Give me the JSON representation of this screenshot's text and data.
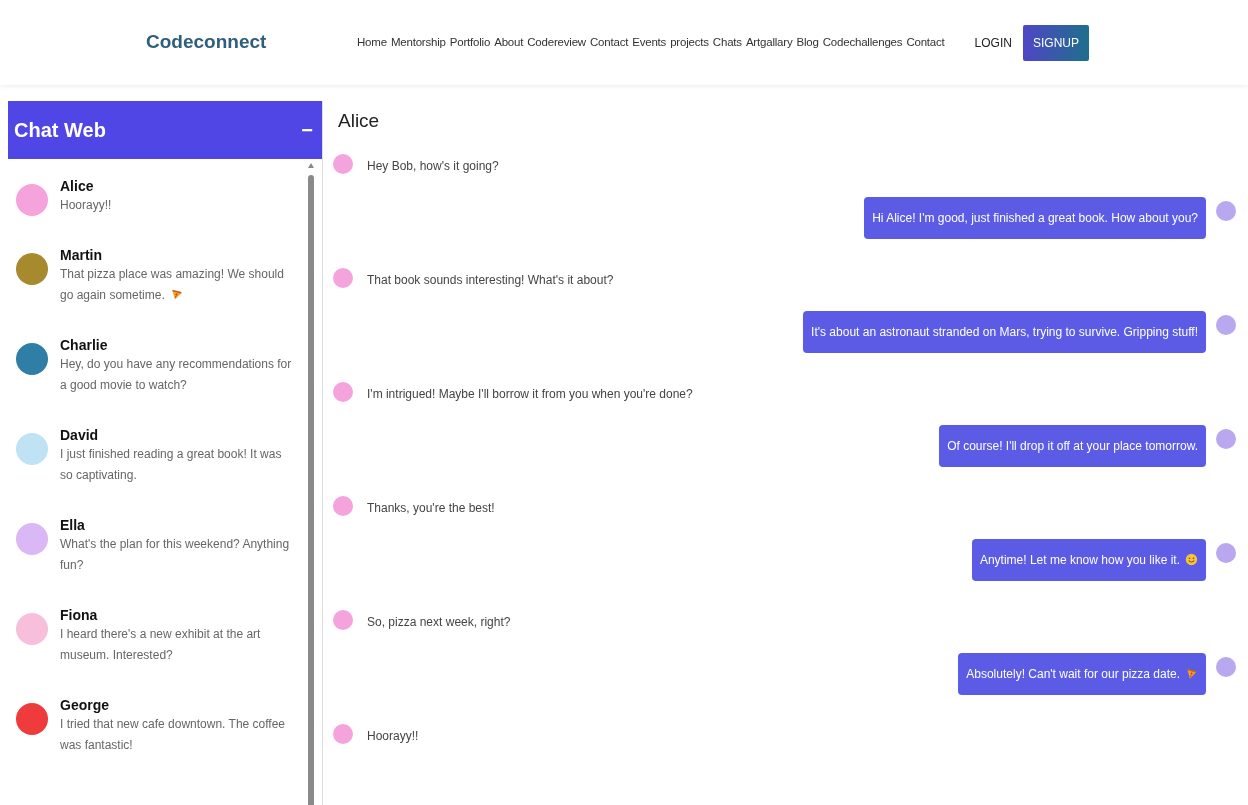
{
  "navbar": {
    "brand": "Codeconnect",
    "links": [
      "Home",
      "Mentorship",
      "Portfolio",
      "About",
      "Codereview",
      "Contact",
      "Events",
      "projects",
      "Chats",
      "Artgallary",
      "Blog",
      "Codechallenges",
      "Contact"
    ],
    "login": "LOGIN",
    "signup": "SIGNUP"
  },
  "sidebar": {
    "title": "Chat Web",
    "collapse_icon": "−",
    "contacts": [
      {
        "name": "Alice",
        "preview": "Hoorayy!!",
        "color": "#f5a3dc"
      },
      {
        "name": "Martin",
        "preview": "That pizza place was amazing! We should go again sometime.",
        "pizza_icon": true,
        "color": "#a88a2e"
      },
      {
        "name": "Charlie",
        "preview": "Hey, do you have any recommendations for a good movie to watch?",
        "color": "#2e7ea6"
      },
      {
        "name": "David",
        "preview": "I just finished reading a great book! It was so captivating.",
        "color": "#bfe3f5"
      },
      {
        "name": "Ella",
        "preview": "What's the plan for this weekend? Anything fun?",
        "color": "#d9b8f5"
      },
      {
        "name": "Fiona",
        "preview": "I heard there's a new exhibit at the art museum. Interested?",
        "color": "#f7bfdc"
      },
      {
        "name": "George",
        "preview": "I tried that new cafe downtown. The coffee was fantastic!",
        "color": "#ef3b3b"
      }
    ]
  },
  "chat": {
    "title": "Alice",
    "messages": [
      {
        "kind": "received",
        "text": "Hey Bob, how's it going?"
      },
      {
        "kind": "sent",
        "text": "Hi Alice! I'm good, just finished a great book. How about you?"
      },
      {
        "kind": "received",
        "text": "That book sounds interesting! What's it about?"
      },
      {
        "kind": "sent",
        "text": "It's about an astronaut stranded on Mars, trying to survive. Gripping stuff!"
      },
      {
        "kind": "received",
        "text": "I'm intrigued! Maybe I'll borrow it from you when you're done?"
      },
      {
        "kind": "sent",
        "text": "Of course! I'll drop it off at your place tomorrow."
      },
      {
        "kind": "received",
        "text": "Thanks, you're the best!"
      },
      {
        "kind": "sent",
        "text": "Anytime! Let me know how you like it.",
        "smile_icon": true
      },
      {
        "kind": "received",
        "text": "So, pizza next week, right?"
      },
      {
        "kind": "sent",
        "text": "Absolutely! Can't wait for our pizza date.",
        "pizza_icon": true
      },
      {
        "kind": "received",
        "text": "Hoorayy!!"
      }
    ]
  }
}
